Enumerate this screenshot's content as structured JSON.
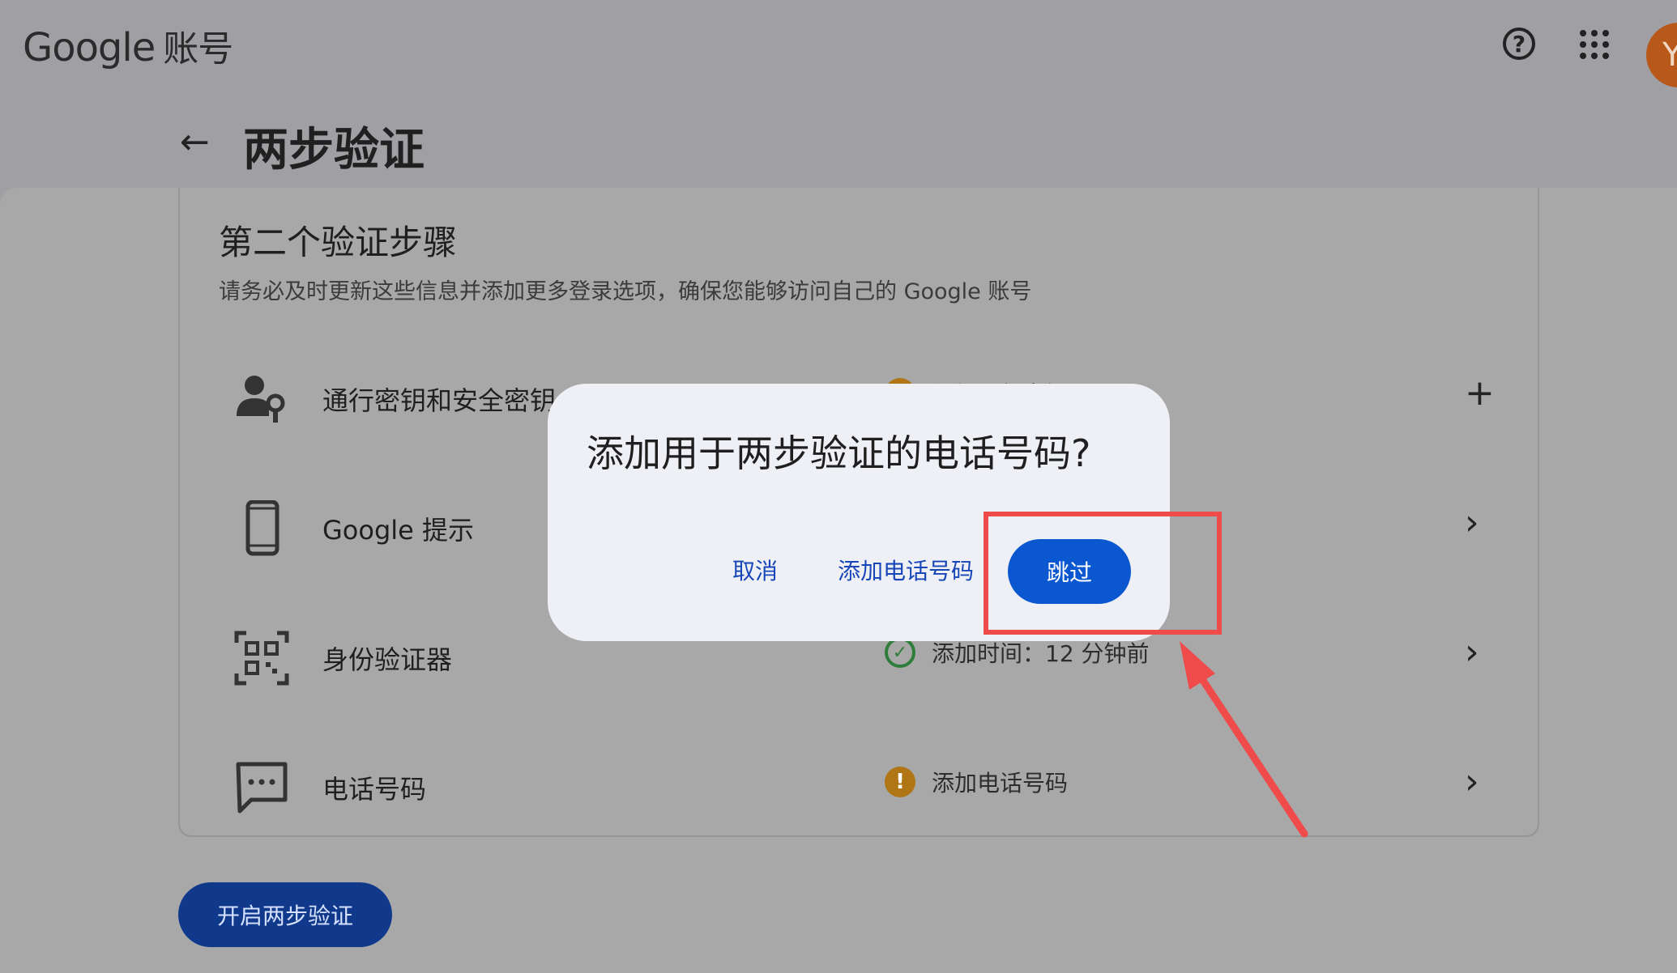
{
  "header": {
    "logo_google": "Google",
    "logo_suffix": "账号",
    "avatar_initial": "Y"
  },
  "page": {
    "title": "两步验证"
  },
  "section": {
    "title": "第二个验证步骤",
    "description": "请务必及时更新这些信息并添加更多登录选项，确保您能够访问自己的 Google 账号"
  },
  "rows": [
    {
      "label": "通行密钥和安全密钥",
      "status": "添加通行密钥",
      "status_icon": "warning-icon",
      "action_icon": "plus-icon",
      "action_glyph": "+"
    },
    {
      "label": "Google 提示",
      "status": "",
      "action_icon": "chevron-right-icon",
      "action_glyph": "›"
    },
    {
      "label": "身份验证器",
      "status": "添加时间：12 分钟前",
      "status_icon": "check-circle-icon",
      "action_icon": "chevron-right-icon",
      "action_glyph": "›"
    },
    {
      "label": "电话号码",
      "status": "添加电话号码",
      "status_icon": "warning-icon",
      "action_icon": "chevron-right-icon",
      "action_glyph": "›"
    }
  ],
  "enable_button": "开启两步验证",
  "dialog": {
    "title": "添加用于两步验证的电话号码?",
    "cancel": "取消",
    "add_phone": "添加电话号码",
    "skip": "跳过"
  },
  "colors": {
    "overlay_background": "#a0a0a4",
    "primary": "#0b57d0",
    "warning": "#b07515",
    "highlight": "#ef4b4b"
  }
}
